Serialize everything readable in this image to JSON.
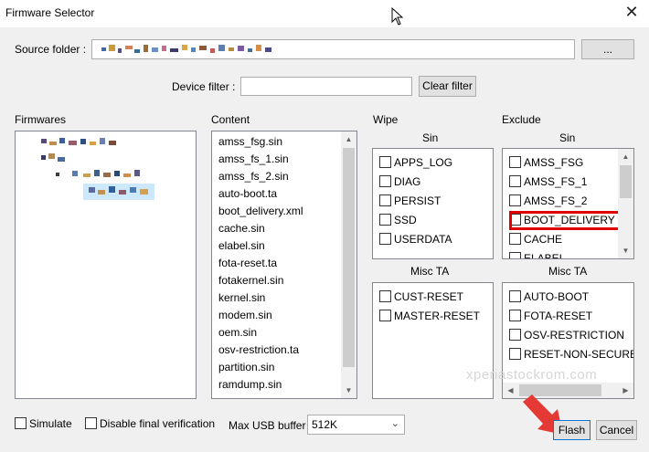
{
  "window": {
    "title": "Firmware Selector",
    "close_glyph": "✕"
  },
  "source": {
    "label": "Source folder :",
    "browse_label": "..."
  },
  "filter": {
    "label": "Device filter :",
    "value": "",
    "clear_label": "Clear filter"
  },
  "firmwares": {
    "label": "Firmwares"
  },
  "content": {
    "label": "Content",
    "items": [
      "amss_fsg.sin",
      "amss_fs_1.sin",
      "amss_fs_2.sin",
      "auto-boot.ta",
      "boot_delivery.xml",
      "cache.sin",
      "elabel.sin",
      "fota-reset.ta",
      "fotakernel.sin",
      "kernel.sin",
      "modem.sin",
      "oem.sin",
      "osv-restriction.ta",
      "partition.sin",
      "ramdump.sin"
    ]
  },
  "wipe": {
    "label": "Wipe",
    "sin_header": "Sin",
    "sin_items": [
      "APPS_LOG",
      "DIAG",
      "PERSIST",
      "SSD",
      "USERDATA"
    ],
    "ta_header": "Misc TA",
    "ta_items": [
      "CUST-RESET",
      "MASTER-RESET"
    ]
  },
  "exclude": {
    "label": "Exclude",
    "sin_header": "Sin",
    "sin_items": [
      "AMSS_FSG",
      "AMSS_FS_1",
      "AMSS_FS_2",
      "BOOT_DELIVERY",
      "CACHE",
      "ELABEL"
    ],
    "highlighted_item": "BOOT_DELIVERY",
    "ta_header": "Misc TA",
    "ta_items": [
      "AUTO-BOOT",
      "FOTA-RESET",
      "OSV-RESTRICTION",
      "RESET-NON-SECURE-A"
    ]
  },
  "options": {
    "simulate_label": "Simulate",
    "disable_verification_label": "Disable final verification",
    "usb_buffer_label": "Max USB buffer",
    "usb_buffer_value": "512K"
  },
  "actions": {
    "flash_label": "Flash",
    "cancel_label": "Cancel"
  },
  "watermark": "xperiastockrom.com",
  "colors": {
    "highlight": "#e00000",
    "arrow": "#e53935",
    "focus": "#0078d7"
  }
}
